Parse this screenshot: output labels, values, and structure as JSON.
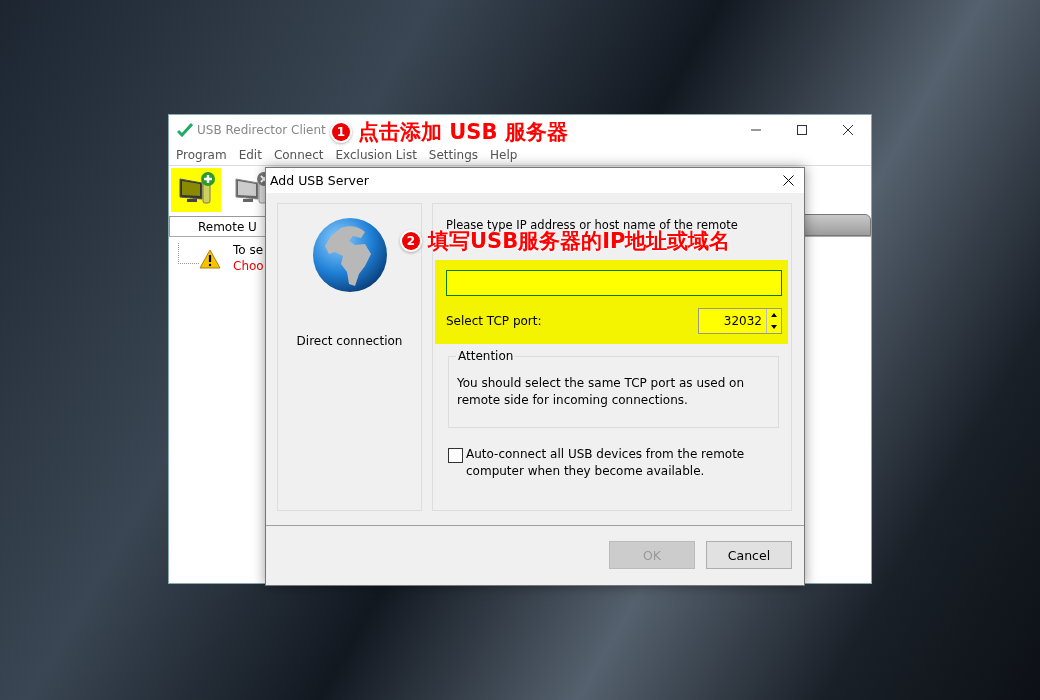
{
  "main_window": {
    "title": "USB Redirector Client",
    "menu": [
      "Program",
      "Edit",
      "Connect",
      "Exclusion List",
      "Settings",
      "Help"
    ],
    "toolbar": [
      {
        "kind": "add-server",
        "highlighted": true
      },
      {
        "kind": "remove-server",
        "highlighted": false
      }
    ],
    "tab": "Remote U",
    "tree": [
      {
        "kind": "text",
        "text": "To se"
      },
      {
        "kind": "link",
        "text": "Choo"
      }
    ]
  },
  "dialog": {
    "title": "Add USB Server",
    "method": "Direct connection",
    "instruction": "Please type IP address or host name of the remote",
    "address": {
      "highlighted": true
    },
    "port_label": "Select TCP port:",
    "port": "32032",
    "attention_title": "Attention",
    "attention_text": "You should select the same TCP port as used on remote side for incoming connections.",
    "auto_connect": {
      "label": "Auto-connect all USB devices from the remote computer when they become available.",
      "checked": false
    },
    "buttons": [
      {
        "label": "OK",
        "disabled": true
      },
      {
        "label": "Cancel",
        "disabled": false
      }
    ]
  },
  "annotations": [
    {
      "number": "1",
      "text": "点击添加 USB 服务器"
    },
    {
      "number": "2",
      "text": "填写USB服务器的IP地址或域名"
    }
  ]
}
